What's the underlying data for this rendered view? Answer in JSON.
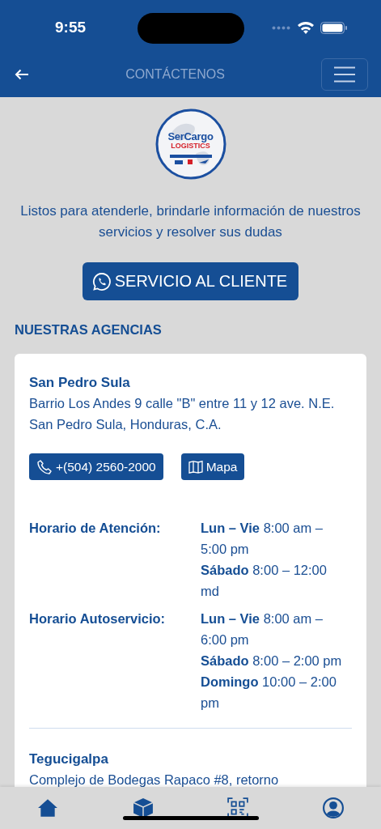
{
  "status_bar": {
    "time": "9:55"
  },
  "header": {
    "title": "CONTÁCTENOS"
  },
  "logo": {
    "line_1": "SerCargo",
    "line_2": "LOGISTICS"
  },
  "intro": "Listos para atenderle, brindarle información de nuestros servicios y resolver sus dudas",
  "service_button": {
    "label": "SERVICIO AL CLIENTE"
  },
  "section_title": "NUESTRAS AGENCIAS",
  "agencies": [
    {
      "name": "San Pedro Sula",
      "address": "Barrio Los Andes 9 calle \"B\" entre 11 y 12 ave. N.E. San Pedro Sula, Honduras, C.A.",
      "phone": "+(504) 2560-2000",
      "map": "Mapa",
      "schedules": [
        {
          "label": "Horario de Atención:",
          "lines": [
            "**Lun – Vie** 8:00 am – 5:00 pm",
            "**Sábado** 8:00 – 12:00 md"
          ]
        },
        {
          "label": "Horario Autoservicio:",
          "lines": [
            "**Lun – Vie** 8:00 am – 6:00 pm",
            "**Sábado** 8:00 – 2:00 pm",
            "**Domingo** 10:00 – 2:00 pm"
          ]
        }
      ]
    },
    {
      "name": "Tegucigalpa",
      "address": "Complejo de Bodegas Rapaco #8, retorno"
    }
  ],
  "tab_bar": [
    {
      "kind": "home",
      "selected": false
    },
    {
      "kind": "package",
      "selected": false
    },
    {
      "kind": "qr",
      "selected": false
    },
    {
      "kind": "profile",
      "selected": false
    }
  ]
}
